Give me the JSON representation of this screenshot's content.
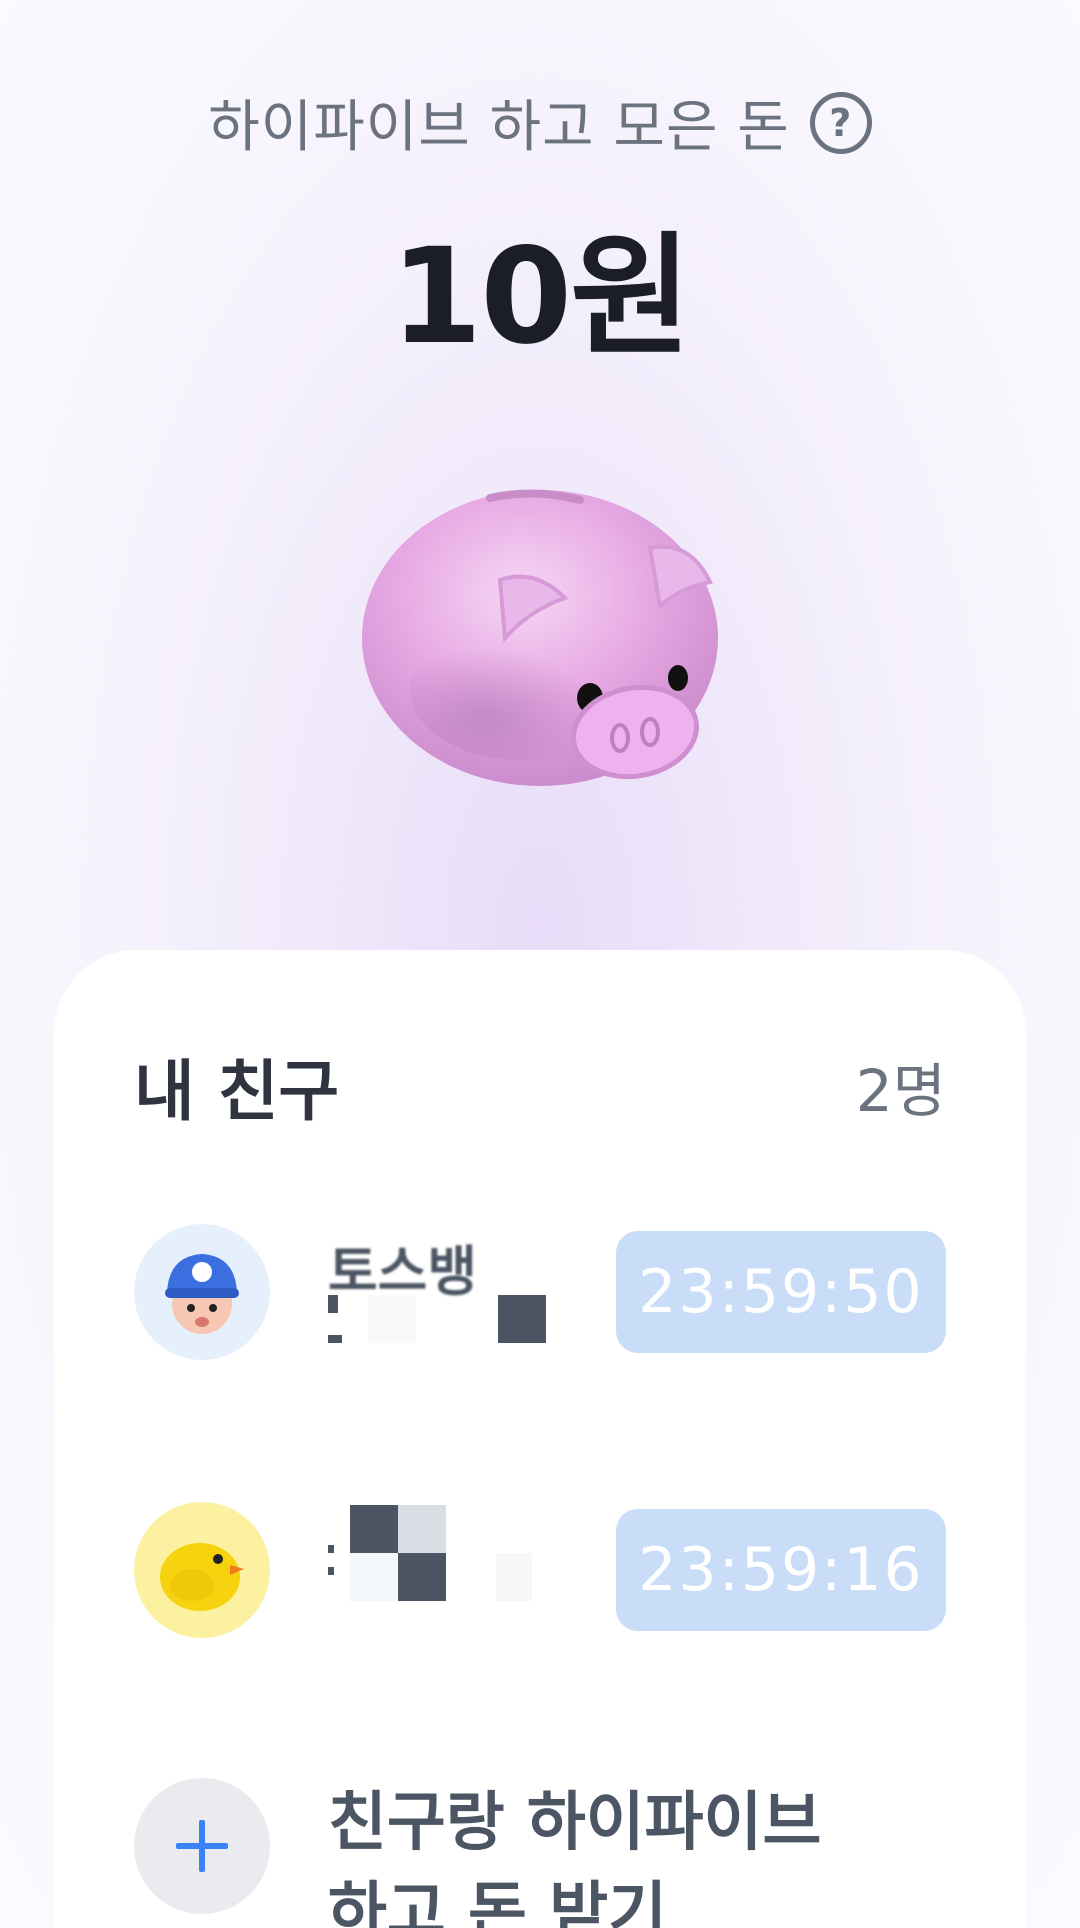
{
  "header": {
    "title": "하이파이브 하고 모은 돈",
    "help_icon": "?",
    "amount": "10원"
  },
  "friends_card": {
    "title": "내 친구",
    "count": "2명",
    "friends": [
      {
        "name": "토스뱅",
        "avatar_icon": "boy-with-blue-cap-icon",
        "timer": "23:59:50"
      },
      {
        "name": "",
        "avatar_icon": "yellow-chick-icon",
        "timer": "23:59:16"
      }
    ],
    "invite": {
      "icon": "plus-icon",
      "line1": "친구랑 하이파이브",
      "line2": "하고 돈 받기"
    }
  },
  "colors": {
    "accent_blue": "#3b82f6",
    "timer_bg": "#c9dcf8",
    "pig_pink": "#e6a8e6"
  }
}
